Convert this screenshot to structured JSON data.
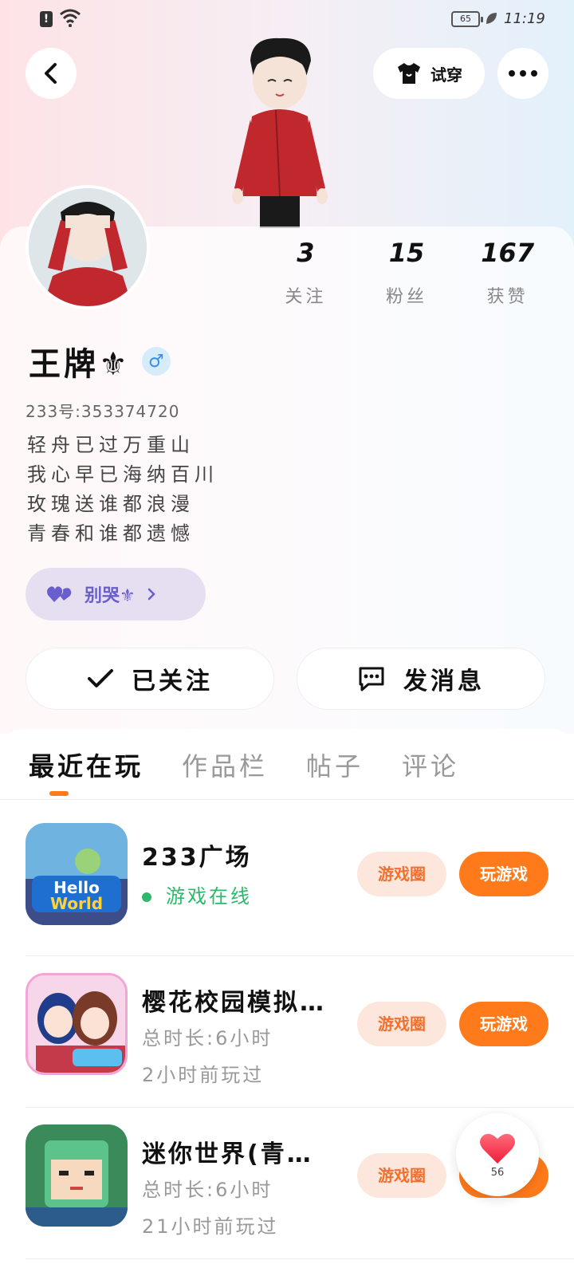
{
  "status_bar": {
    "battery": "65",
    "time": "11:19"
  },
  "header": {
    "try_on_label": "试穿"
  },
  "stats": [
    {
      "value": "3",
      "label": "关注"
    },
    {
      "value": "15",
      "label": "粉丝"
    },
    {
      "value": "167",
      "label": "获赞"
    }
  ],
  "profile": {
    "name": "王牌⚜",
    "gender_symbol": "♂",
    "uid": "233号:353374720",
    "bio": [
      "轻舟已过万重山",
      "我心早已海纳百川",
      "玫瑰送谁都浪漫",
      "青春和谁都遗憾"
    ],
    "tag": "别哭⚜"
  },
  "actions": {
    "follow": "已关注",
    "message": "发消息"
  },
  "tabs": [
    "最近在玩",
    "作品栏",
    "帖子",
    "评论"
  ],
  "games": [
    {
      "title": "233广场",
      "status": "游戏在线",
      "line1": "",
      "line2": ""
    },
    {
      "title": "樱花校园模拟…",
      "status": "",
      "line1": "总时长:6小时",
      "line2": "2小时前玩过"
    },
    {
      "title": "迷你世界(青…",
      "status": "",
      "line1": "总时长:6小时",
      "line2": "21小时前玩过"
    }
  ],
  "game_buttons": {
    "circle": "游戏圈",
    "play": "玩游戏"
  },
  "like": {
    "count": "56"
  },
  "colors": {
    "accent": "#ff7a1a",
    "online": "#2fb86b",
    "tag_text": "#6a5ecf"
  }
}
